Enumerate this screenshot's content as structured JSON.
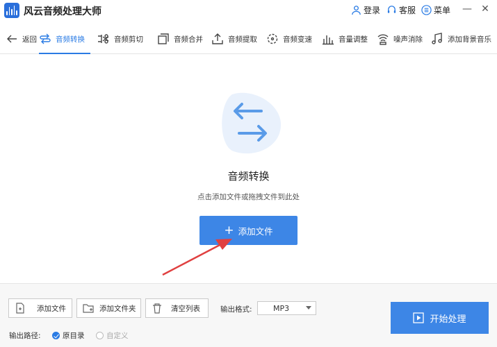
{
  "app": {
    "title": "风云音频处理大师"
  },
  "titlebar": {
    "login": "登录",
    "service": "客服",
    "menu": "菜单",
    "minimize": "—",
    "close": "✕"
  },
  "toolbar": {
    "back": "返回",
    "tools": [
      "音频转换",
      "音频剪切",
      "音频合并",
      "音频提取",
      "音频变速",
      "音量调整",
      "噪声消除",
      "添加背景音乐"
    ]
  },
  "main": {
    "title": "音频转换",
    "hint": "点击添加文件或拖拽文件到此处",
    "add_button": "添加文件",
    "add_plus": "+"
  },
  "bottom": {
    "add_file": "添加文件",
    "add_folder": "添加文件夹",
    "clear_list": "清空列表",
    "format_label": "输出格式:",
    "format_value": "MP3",
    "path_label": "输出路径:",
    "path_original": "原目录",
    "path_custom": "自定义",
    "start": "开始处理"
  },
  "colors": {
    "accent": "#2a7be4",
    "button": "#3d86e6",
    "arrow": "#e04040"
  }
}
